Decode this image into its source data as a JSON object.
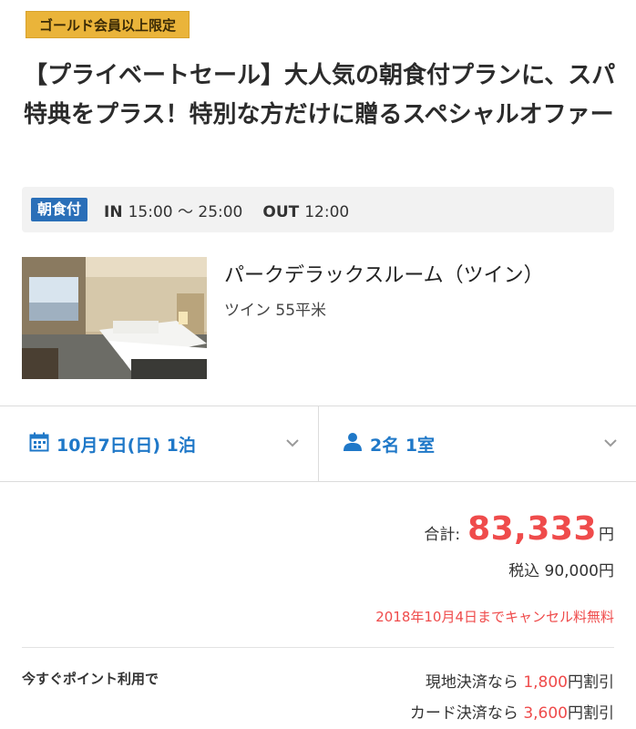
{
  "badge": "ゴールド会員以上限定",
  "plan_title": "【プライベートセール】大人気の朝食付プランに、スパ特典をプラス！特別な方だけに贈るスペシャルオファー",
  "meal_tag": "朝食付",
  "checkin": {
    "in_label": "IN",
    "in_time": "15:00 〜 25:00",
    "out_label": "OUT",
    "out_time": "12:00"
  },
  "room": {
    "name": "パークデラックスルーム（ツイン）",
    "sub": "ツイン 55平米"
  },
  "selectors": {
    "date": "10月7日(日) 1泊",
    "guests": "2名 1室"
  },
  "price": {
    "total_label": "合計:",
    "total_value": "83,333",
    "yen": "円",
    "tax_text": "税込 90,000円",
    "cancel_text": "2018年10月4日までキャンセル料無料"
  },
  "points": {
    "label": "今すぐポイント利用で",
    "discounts": [
      {
        "prefix": "現地決済なら ",
        "amount": "1,800",
        "suffix": "円割引"
      },
      {
        "prefix": "カード決済なら ",
        "amount": "3,600",
        "suffix": "円割引"
      }
    ]
  },
  "colors": {
    "accent_blue": "#1f78c8",
    "price_red": "#ef4b4b",
    "badge_gold": "#eab43a",
    "meal_tag_blue": "#2a6fb8"
  },
  "icons": {
    "date": "calendar-icon",
    "guests": "person-icon",
    "dropdown": "chevron-down-icon"
  }
}
